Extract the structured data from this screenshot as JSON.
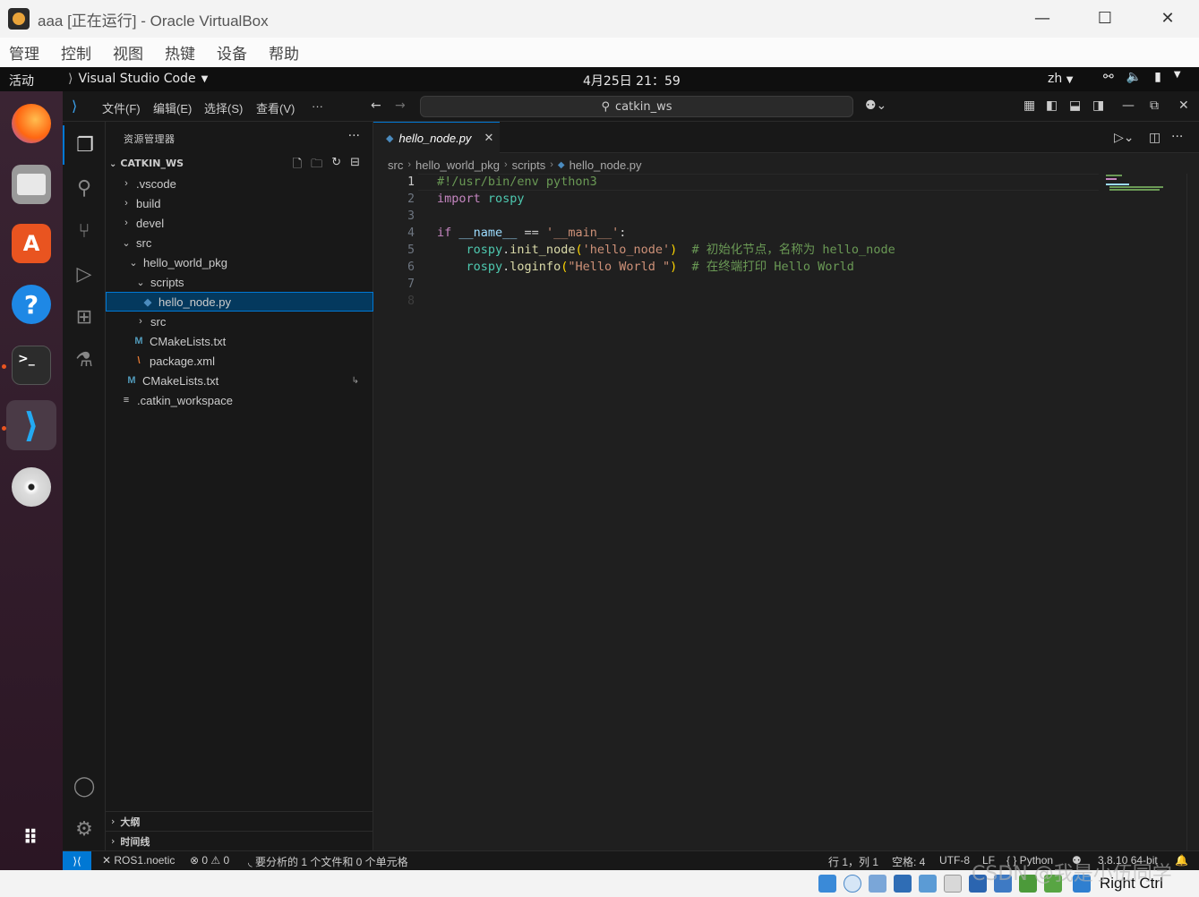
{
  "vbox": {
    "title": "aaa [正在运行] - Oracle VirtualBox",
    "menu": [
      "管理",
      "控制",
      "视图",
      "热键",
      "设备",
      "帮助"
    ],
    "host_key": "Right Ctrl"
  },
  "gnome": {
    "activities": "活动",
    "app_name": "Visual Studio Code",
    "clock": "4月25日  21：59",
    "lang": "zh"
  },
  "dock": {
    "items": [
      "firefox-icon",
      "files-icon",
      "app-center-icon",
      "help-icon",
      "terminal-icon",
      "vscode-icon",
      "disc-icon",
      "show-apps-icon"
    ]
  },
  "vscode": {
    "menu": [
      "文件(F)",
      "编辑(E)",
      "选择(S)",
      "查看(V)",
      "···"
    ],
    "search_text": "catkin_ws",
    "sidebar": {
      "header": "资源管理器",
      "more": "···",
      "workspace": "CATKIN_WS",
      "tree": [
        {
          "label": ".vscode",
          "chev": "›"
        },
        {
          "label": "build",
          "chev": "›"
        },
        {
          "label": "devel",
          "chev": "›"
        },
        {
          "label": "src",
          "chev": "⌄"
        },
        {
          "label": "hello_world_pkg",
          "chev": "⌄"
        },
        {
          "label": "scripts",
          "chev": "⌄"
        },
        {
          "label": "hello_node.py"
        },
        {
          "label": "src",
          "chev": "›"
        },
        {
          "label": "CMakeLists.txt",
          "icon": "M"
        },
        {
          "label": "package.xml",
          "icon": "\\"
        },
        {
          "label": "CMakeLists.txt",
          "icon": "M"
        },
        {
          "label": ".catkin_workspace",
          "icon": "≡"
        }
      ],
      "outline": "大纲",
      "timeline": "时间线"
    },
    "tab": {
      "label": "hello_node.py",
      "close": "✕"
    },
    "breadcrumb": [
      "src",
      "hello_world_pkg",
      "scripts",
      "hello_node.py"
    ],
    "line_numbers": [
      "1",
      "2",
      "3",
      "4",
      "5",
      "6",
      "7",
      "8"
    ],
    "code": {
      "l1": "#!/usr/bin/env python3",
      "l2_kw": "import",
      "l2_mod": " rospy",
      "l4_if": "if",
      "l4_name": " __name__",
      "l4_op": " == ",
      "l4_str": "'__main__'",
      "l4_colon": ":",
      "l5_mod": "rospy",
      "l5_dot": ".",
      "l5_fn": "init_node",
      "l5_open": "(",
      "l5_str": "'hello_node'",
      "l5_close": ")",
      "l5_comment": "  # 初始化节点，名称为 hello_node",
      "l6_mod": "rospy",
      "l6_dot": ".",
      "l6_fn": "loginfo",
      "l6_open": "(",
      "l6_str": "\"Hello World \"",
      "l6_close": ")",
      "l6_comment": "  # 在终端打印 Hello World"
    },
    "status": {
      "remote": "ROS1.noetic",
      "problems": "⊗ 0 ⚠ 0",
      "analysis": "要分析的 1 个文件和 0 个单元格",
      "position": "行 1，列 1",
      "spaces": "空格: 4",
      "encoding": "UTF-8",
      "eol": "LF",
      "language": "{ } Python",
      "interpreter": "3.8.10 64-bit"
    }
  },
  "watermark": "CSDN @我是小伍同学",
  "colors": {
    "accent": "#0078d4",
    "editor_bg": "#1f1f1f",
    "ubuntu_orange": "#e95420"
  }
}
